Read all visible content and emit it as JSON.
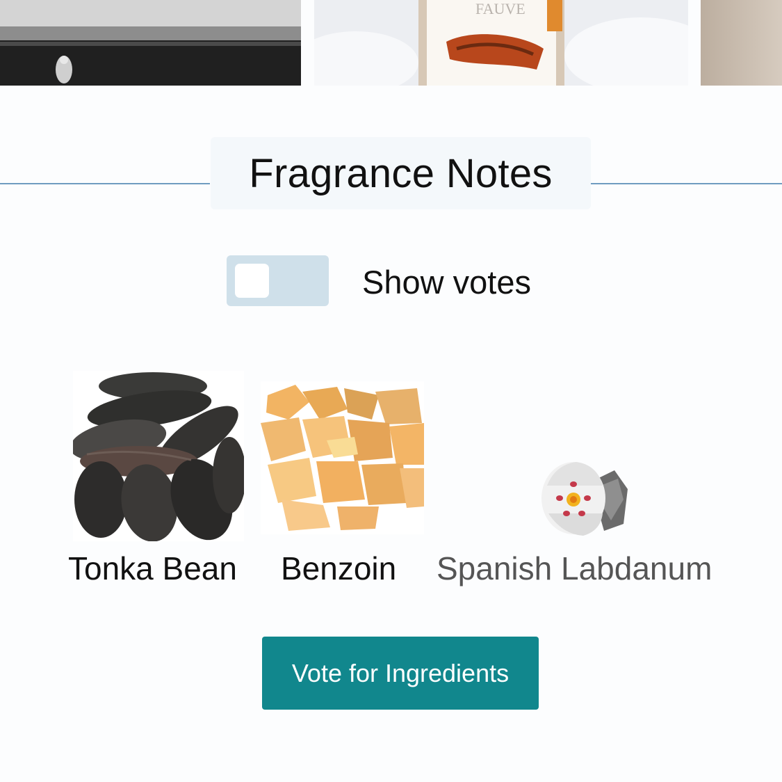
{
  "gallery": {
    "thumb2_text": "FAUVE"
  },
  "section": {
    "title": "Fragrance Notes"
  },
  "toggle": {
    "label": "Show votes",
    "checked": false
  },
  "notes": [
    {
      "name": "Tonka Bean"
    },
    {
      "name": "Benzoin"
    },
    {
      "name": "Spanish Labdanum"
    }
  ],
  "actions": {
    "vote_label": "Vote for Ingredients"
  },
  "colors": {
    "accent": "#11878d",
    "rule": "#6f9cc0",
    "toggle_bg": "#cfe0ea"
  }
}
